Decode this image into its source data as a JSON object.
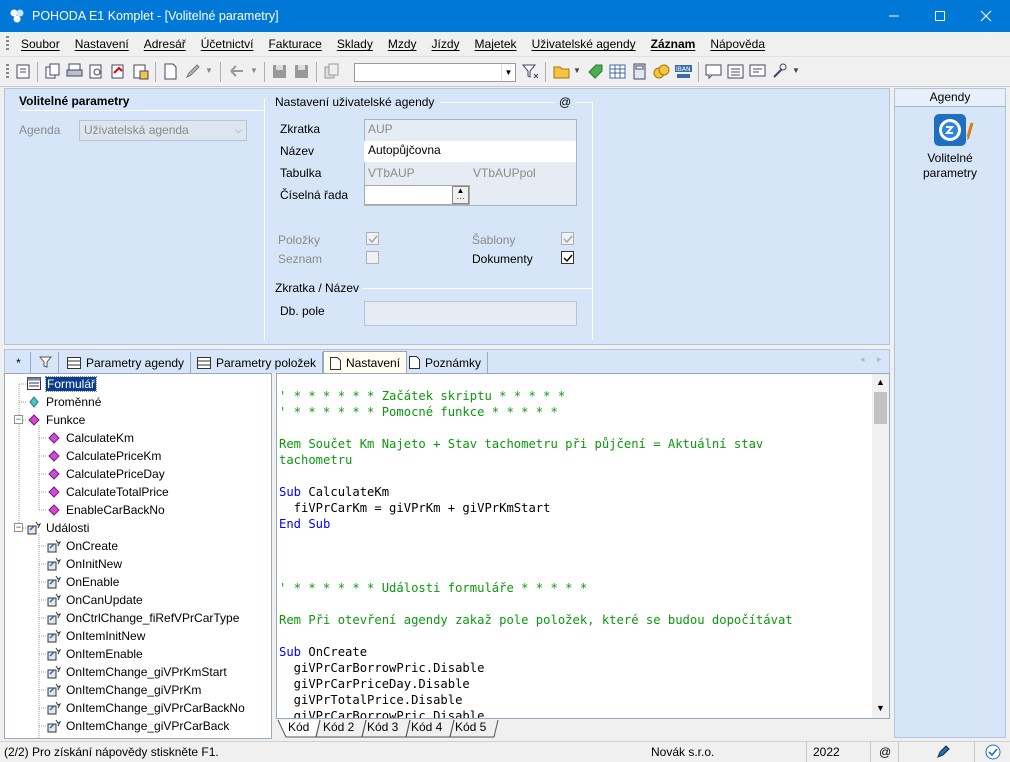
{
  "window": {
    "title": "POHODA E1 Komplet - [Volitelné parametry]"
  },
  "menu": [
    "Soubor",
    "Nastavení",
    "Adresář",
    "Účetnictví",
    "Fakturace",
    "Sklady",
    "Mzdy",
    "Jízdy",
    "Majetek",
    "Uživatelské agendy",
    "Záznam",
    "Nápověda"
  ],
  "toolbar": {
    "combo_value": ""
  },
  "params": {
    "heading": "Volitelné parametry",
    "agenda_label": "Agenda",
    "agenda_value": "Uživatelská agenda"
  },
  "user_agenda": {
    "heading": "Nastavení uživatelské agendy",
    "at_symbol": "@",
    "zkratka_label": "Zkratka",
    "zkratka_value": "AUP",
    "nazev_label": "Název",
    "nazev_value": "Autopůjčovna",
    "tabulka_label": "Tabulka",
    "tabulka_value1": "VTbAUP",
    "tabulka_value2": "VTbAUPpol",
    "ciselna_label": "Číselná řada",
    "ciselna_value": "",
    "polozky_label": "Položky",
    "seznam_label": "Seznam",
    "sablony_label": "Šablony",
    "dokumenty_label": "Dokumenty",
    "polozky_checked": true,
    "seznam_checked": false,
    "sablony_checked": true,
    "dokumenty_checked": true
  },
  "zkratka_nazev": {
    "heading": "Zkratka / Název",
    "dbpole_label": "Db. pole",
    "dbpole_value": ""
  },
  "agenda_panel": {
    "heading": "Agendy",
    "item_line1": "Volitelné",
    "item_line2": "parametry"
  },
  "tabs": {
    "star": "*",
    "items": [
      {
        "label": "Parametry agendy"
      },
      {
        "label": "Parametry položek"
      },
      {
        "label": "Nastavení"
      },
      {
        "label": "Poznámky"
      }
    ]
  },
  "tree": [
    {
      "label": "Formulář",
      "level": 0,
      "icon": "form-icon",
      "selected": true
    },
    {
      "label": "Proměnné",
      "level": 0,
      "icon": "variable-icon"
    },
    {
      "label": "Funkce",
      "level": 0,
      "icon": "function-icon",
      "expandable": true
    },
    {
      "label": "CalculateKm",
      "level": 1,
      "icon": "function-icon"
    },
    {
      "label": "CalculatePriceKm",
      "level": 1,
      "icon": "function-icon"
    },
    {
      "label": "CalculatePriceDay",
      "level": 1,
      "icon": "function-icon"
    },
    {
      "label": "CalculateTotalPrice",
      "level": 1,
      "icon": "function-icon"
    },
    {
      "label": "EnableCarBackNo",
      "level": 1,
      "icon": "function-icon"
    },
    {
      "label": "Události",
      "level": 0,
      "icon": "event-icon",
      "expandable": true
    },
    {
      "label": "OnCreate",
      "level": 1,
      "icon": "event-icon"
    },
    {
      "label": "OnInitNew",
      "level": 1,
      "icon": "event-icon"
    },
    {
      "label": "OnEnable",
      "level": 1,
      "icon": "event-icon"
    },
    {
      "label": "OnCanUpdate",
      "level": 1,
      "icon": "event-icon"
    },
    {
      "label": "OnCtrlChange_fiRefVPrCarType",
      "level": 1,
      "icon": "event-icon"
    },
    {
      "label": "OnItemInitNew",
      "level": 1,
      "icon": "event-icon"
    },
    {
      "label": "OnItemEnable",
      "level": 1,
      "icon": "event-icon"
    },
    {
      "label": "OnItemChange_giVPrKmStart",
      "level": 1,
      "icon": "event-icon"
    },
    {
      "label": "OnItemChange_giVPrKm",
      "level": 1,
      "icon": "event-icon"
    },
    {
      "label": "OnItemChange_giVPrCarBackNo",
      "level": 1,
      "icon": "event-icon"
    },
    {
      "label": "OnItemChange_giVPrCarBack",
      "level": 1,
      "icon": "event-icon"
    }
  ],
  "code": [
    {
      "t": "' * * * * * * Začátek skriptu * * * * *",
      "k": "cm"
    },
    {
      "t": "' * * * * * * Pomocné funkce * * * * *",
      "k": "cm"
    },
    {
      "t": "",
      "k": ""
    },
    {
      "t": "Rem Součet Km Najeto + Stav tachometru při půjčení = Aktuální stav",
      "k": "cm"
    },
    {
      "t": "tachometru",
      "k": "cm"
    },
    {
      "t": "",
      "k": ""
    },
    {
      "t": "Sub CalculateKm",
      "k": "sub"
    },
    {
      "t": "  fiVPrCarKm = giVPrKm + giVPrKmStart",
      "k": ""
    },
    {
      "t": "End Sub",
      "k": "kw"
    },
    {
      "t": "",
      "k": ""
    },
    {
      "t": "",
      "k": ""
    },
    {
      "t": "",
      "k": ""
    },
    {
      "t": "' * * * * * * Události formuláře * * * * *",
      "k": "cm"
    },
    {
      "t": "",
      "k": ""
    },
    {
      "t": "Rem Při otevření agendy zakaž pole položek, které se budou dopočítávat",
      "k": "cm"
    },
    {
      "t": "",
      "k": ""
    },
    {
      "t": "Sub OnCreate",
      "k": "sub"
    },
    {
      "t": "  giVPrCarBorrowPric.Disable",
      "k": ""
    },
    {
      "t": "  giVPrCarPriceDay.Disable",
      "k": ""
    },
    {
      "t": "  giVPrTotalPrice.Disable",
      "k": ""
    },
    {
      "t": "  giVPrCarBorrowPric.Disable",
      "k": ""
    }
  ],
  "code_tabs": [
    "Kód",
    "Kód 2",
    "Kód 3",
    "Kód 4",
    "Kód 5"
  ],
  "status": {
    "help": "(2/2) Pro získání nápovědy stiskněte F1.",
    "company": "Novák s.r.o.",
    "year": "2022",
    "at": "@"
  },
  "colors": {
    "titlebar": "#0078d7",
    "panel": "#d6e5f7",
    "comment": "#0a9a0a",
    "keyword": "#0000ff"
  }
}
